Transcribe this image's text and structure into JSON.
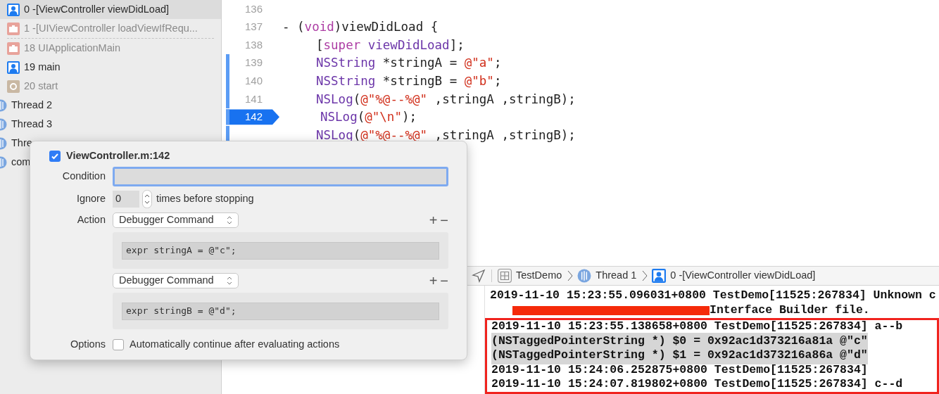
{
  "sidebar": {
    "items": [
      {
        "kind": "user",
        "label": "0 -[ViewController viewDidLoad]",
        "selected": true
      },
      {
        "kind": "system",
        "label": "1 -[UIViewController loadViewIfRequ...",
        "selected": false,
        "separator_after": true
      },
      {
        "kind": "system",
        "label": "18 UIApplicationMain",
        "selected": false
      },
      {
        "kind": "user",
        "label": "19 main",
        "selected": false
      },
      {
        "kind": "start",
        "label": "20 start",
        "selected": false
      },
      {
        "kind": "thread",
        "label": "Thread 2",
        "selected": false
      },
      {
        "kind": "thread",
        "label": "Thread 3",
        "selected": false
      },
      {
        "kind": "thread",
        "label": "Thre",
        "selected": false
      },
      {
        "kind": "thread",
        "label": "com",
        "selected": false
      }
    ]
  },
  "editor": {
    "lines": [
      {
        "number": "136",
        "indented": false,
        "changed": false,
        "breakpoint": false
      },
      {
        "number": "137",
        "indented": false,
        "changed": false,
        "breakpoint": false,
        "tokens": [
          {
            "text": "- (",
            "kind": "plain"
          },
          {
            "text": "void",
            "kind": "keyword"
          },
          {
            "text": ")viewDidLoad {",
            "kind": "plain"
          }
        ]
      },
      {
        "number": "138",
        "indented": true,
        "changed": false,
        "breakpoint": false,
        "tokens": [
          {
            "text": "[",
            "kind": "plain"
          },
          {
            "text": "super ",
            "kind": "keyword"
          },
          {
            "text": "viewDidLoad",
            "kind": "type"
          },
          {
            "text": "];",
            "kind": "plain"
          }
        ]
      },
      {
        "number": "139",
        "indented": true,
        "changed": true,
        "breakpoint": false,
        "tokens": [
          {
            "text": "NSString",
            "kind": "type"
          },
          {
            "text": " *stringA = ",
            "kind": "plain"
          },
          {
            "text": "@\"a\"",
            "kind": "string"
          },
          {
            "text": ";",
            "kind": "plain"
          }
        ]
      },
      {
        "number": "140",
        "indented": true,
        "changed": true,
        "breakpoint": false,
        "tokens": [
          {
            "text": "NSString",
            "kind": "type"
          },
          {
            "text": " *stringB = ",
            "kind": "plain"
          },
          {
            "text": "@\"b\"",
            "kind": "string"
          },
          {
            "text": ";",
            "kind": "plain"
          }
        ]
      },
      {
        "number": "141",
        "indented": true,
        "changed": true,
        "breakpoint": false,
        "tokens": [
          {
            "text": "NSLog",
            "kind": "type"
          },
          {
            "text": "(",
            "kind": "plain"
          },
          {
            "text": "@\"%@--%@\"",
            "kind": "string"
          },
          {
            "text": " ,stringA ,stringB);",
            "kind": "plain"
          }
        ]
      },
      {
        "number": "142",
        "indented": true,
        "changed": true,
        "breakpoint": true,
        "tokens": [
          {
            "text": "NSLog",
            "kind": "type"
          },
          {
            "text": "(",
            "kind": "plain"
          },
          {
            "text": "@\"\\n\"",
            "kind": "string"
          },
          {
            "text": ");",
            "kind": "plain"
          }
        ]
      },
      {
        "indented": true,
        "changed": true,
        "breakpoint": false,
        "tokens": [
          {
            "text": "NSLog",
            "kind": "type"
          },
          {
            "text": "(",
            "kind": "plain"
          },
          {
            "text": "@\"%@--%@\"",
            "kind": "string"
          },
          {
            "text": " ,stringA ,stringB);",
            "kind": "plain"
          }
        ]
      }
    ]
  },
  "breakpoint_popover": {
    "enabled": true,
    "title": "ViewController.m:142",
    "condition": {
      "label": "Condition",
      "focused": true
    },
    "ignore": {
      "label": "Ignore",
      "value": "0",
      "suffix": "times before stopping"
    },
    "actions": [
      {
        "label": "Action",
        "type": "Debugger Command",
        "command": "expr stringA = @\"c\";",
        "add": "+",
        "remove": "−"
      },
      {
        "type": "Debugger Command",
        "command": "expr stringB = @\"d\";",
        "add": "+",
        "remove": "−"
      }
    ],
    "options": {
      "label": "Options",
      "checked": false,
      "text": "Automatically continue after evaluating actions"
    }
  },
  "debug_bar": {
    "breadcrumbs": [
      {
        "kind": "app",
        "label": "TestDemo"
      },
      {
        "kind": "thread",
        "label": "Thread 1"
      },
      {
        "kind": "user",
        "label": "0 -[ViewController viewDidLoad]"
      }
    ]
  },
  "console": {
    "lines": [
      {
        "text": "2019-11-10 15:23:55.096031+0800 TestDemo[11525:267834] Unknown c",
        "boxed": false,
        "selected": false,
        "redacted": false
      },
      {
        "text": "Interface Builder file.",
        "boxed": false,
        "selected": false,
        "redacted": true
      },
      {
        "text": "2019-11-10 15:23:55.138658+0800 TestDemo[11525:267834] a--b",
        "boxed": true,
        "selected": false,
        "redacted": false
      },
      {
        "text": "(NSTaggedPointerString *) $0 = 0x92ac1d373216a81a @\"c\"",
        "boxed": true,
        "selected": true,
        "redacted": false
      },
      {
        "text": "(NSTaggedPointerString *) $1 = 0x92ac1d373216a86a @\"d\"",
        "boxed": true,
        "selected": true,
        "redacted": false
      },
      {
        "text": "2019-11-10 15:24:06.252875+0800 TestDemo[11525:267834]",
        "boxed": true,
        "selected": false,
        "redacted": false
      },
      {
        "text": "2019-11-10 15:24:07.819802+0800 TestDemo[11525:267834] c--d",
        "boxed": true,
        "selected": false,
        "redacted": false
      }
    ]
  }
}
